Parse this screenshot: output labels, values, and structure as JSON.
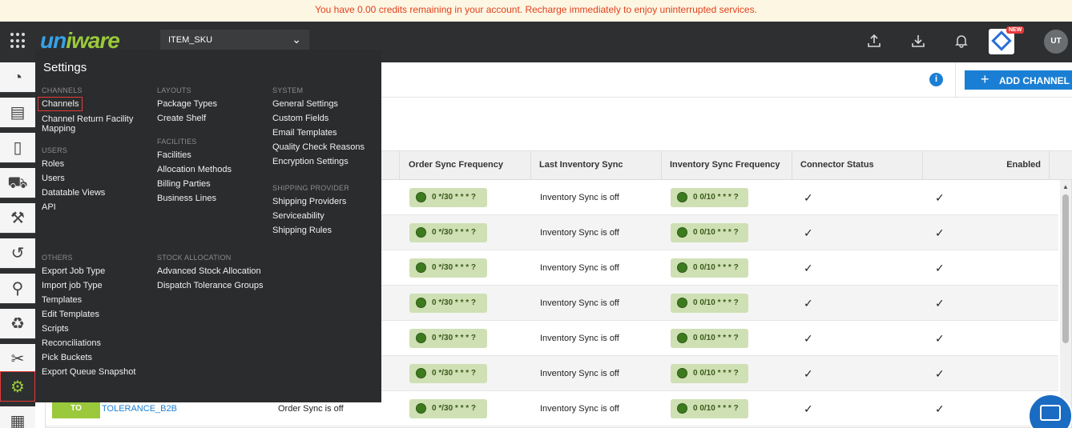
{
  "banner": {
    "text": "You have 0.00 credits remaining in your account. Recharge immediately to enjoy uninterrupted services."
  },
  "header": {
    "logo_text": {
      "u": "un",
      "w": "ware",
      "mid": "i"
    },
    "facility_select": "ITEM_SKU",
    "new_badge": "NEW",
    "avatar": "UT"
  },
  "toolbar": {
    "add_channel_label": "ADD CHANNEL",
    "info_glyph": "i"
  },
  "table": {
    "headers": {
      "order_sync_frequency": "Order Sync Frequency",
      "last_inventory_sync": "Last Inventory Sync",
      "inventory_sync_frequency": "Inventory Sync Frequency",
      "connector_status": "Connector Status",
      "enabled": "Enabled"
    },
    "rows": [
      {
        "order_sync_freq": "0 */30 * * * ?",
        "last_inventory_sync": "Inventory Sync is off",
        "inventory_sync_freq": "0 0/10 * * * ?"
      },
      {
        "order_sync_freq": "0 */30 * * * ?",
        "last_inventory_sync": "Inventory Sync is off",
        "inventory_sync_freq": "0 0/10 * * * ?"
      },
      {
        "order_sync_freq": "0 */30 * * * ?",
        "last_inventory_sync": "Inventory Sync is off",
        "inventory_sync_freq": "0 0/10 * * * ?"
      },
      {
        "order_sync_freq": "0 */30 * * * ?",
        "last_inventory_sync": "Inventory Sync is off",
        "inventory_sync_freq": "0 0/10 * * * ?"
      },
      {
        "order_sync_freq": "0 */30 * * * ?",
        "last_inventory_sync": "Inventory Sync is off",
        "inventory_sync_freq": "0 0/10 * * * ?"
      },
      {
        "order_sync_freq": "0 */30 * * * ?",
        "last_inventory_sync": "Inventory Sync is off",
        "inventory_sync_freq": "0 0/10 * * * ?"
      },
      {
        "order_sync_freq": "0 */30 * * * ?",
        "last_inventory_sync": "Inventory Sync is off",
        "inventory_sync_freq": "0 0/10 * * * ?",
        "channel_pill": "TO",
        "channel_name": "TOLERANCE_B2B",
        "order_sync_status": "Order Sync is off"
      }
    ],
    "check_glyph": "✓"
  },
  "settings": {
    "title": "Settings",
    "sections": {
      "channels": {
        "heading": "CHANNELS",
        "items": [
          "Channels",
          "Channel Return Facility Mapping"
        ]
      },
      "users": {
        "heading": "USERS",
        "items": [
          "Roles",
          "Users",
          "Datatable Views",
          "API"
        ]
      },
      "others": {
        "heading": "OTHERS",
        "items": [
          "Export Job Type",
          "Import job Type",
          "Templates",
          "Edit Templates",
          "Scripts",
          "Reconciliations",
          "Pick Buckets",
          "Export Queue Snapshot"
        ]
      },
      "layouts": {
        "heading": "LAYOUTS",
        "items": [
          "Package Types",
          "Create Shelf"
        ]
      },
      "facilities": {
        "heading": "FACILITIES",
        "items": [
          "Facilities",
          "Allocation Methods",
          "Billing Parties",
          "Business Lines"
        ]
      },
      "stock_allocation": {
        "heading": "STOCK ALLOCATION",
        "items": [
          "Advanced Stock Allocation",
          "Dispatch Tolerance Groups"
        ]
      },
      "system": {
        "heading": "SYSTEM",
        "items": [
          "General Settings",
          "Custom Fields",
          "Email Templates",
          "Quality Check Reasons",
          "Encryption Settings"
        ]
      },
      "shipping_provider": {
        "heading": "SHIPPING PROVIDER",
        "items": [
          "Shipping Providers",
          "Serviceability",
          "Shipping Rules"
        ]
      }
    }
  },
  "colors": {
    "accent": "#1a7fd4",
    "brand_green": "#9ac93c",
    "banner_text": "#e2411d",
    "highlight": "#e63b3b"
  },
  "icons": [
    "apps-grid-icon",
    "upload-icon",
    "download-icon",
    "bell-icon",
    "dashboard-icon",
    "orders-icon",
    "shipments-icon",
    "cart-icon",
    "forklift-icon",
    "returns-icon",
    "product-icon",
    "recycle-icon",
    "tools-icon",
    "settings-gear-icon",
    "inventory-icon",
    "clock-icon",
    "chat-icon"
  ]
}
